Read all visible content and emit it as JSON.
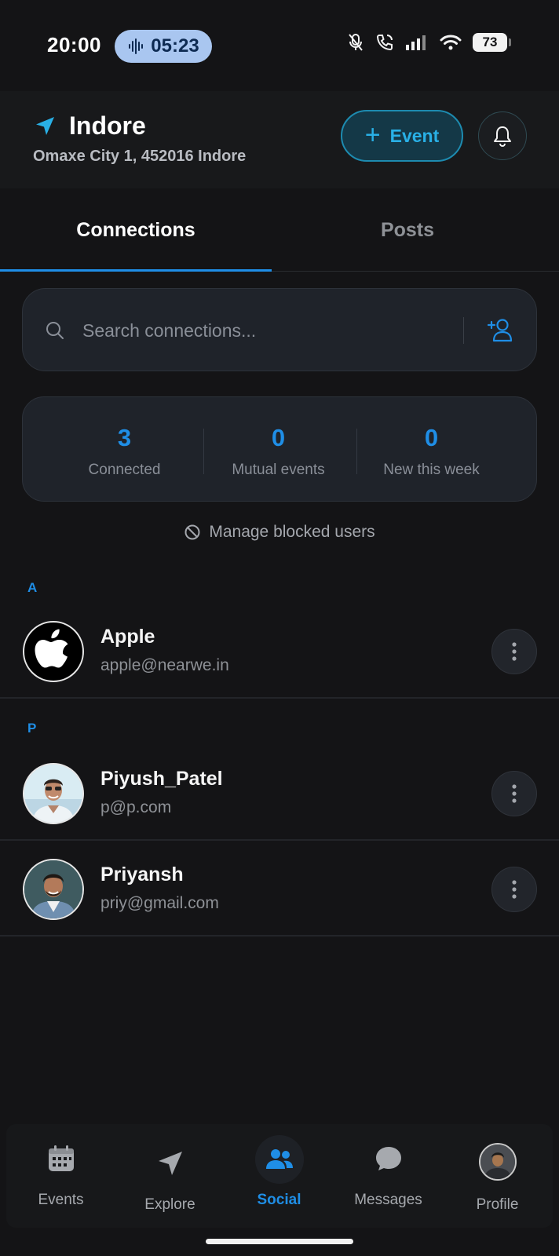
{
  "status_bar": {
    "time": "20:00",
    "call_timer": "05:23",
    "battery": "73",
    "icons": [
      "waveform-icon",
      "mic-off-icon",
      "wifi-calling-icon",
      "signal-icon",
      "wifi-icon",
      "battery-icon"
    ]
  },
  "header": {
    "city": "Indore",
    "address": "Omaxe City 1, 452016 Indore",
    "event_button_label": "Event",
    "accent_color": "#29b0e6"
  },
  "tabs": [
    {
      "label": "Connections",
      "active": true
    },
    {
      "label": "Posts",
      "active": false
    }
  ],
  "search": {
    "placeholder": "Search connections...",
    "value": ""
  },
  "stats": [
    {
      "value": "3",
      "label": "Connected"
    },
    {
      "value": "0",
      "label": "Mutual events"
    },
    {
      "value": "0",
      "label": "New this week"
    }
  ],
  "blocked_link": "Manage blocked users",
  "sections": [
    {
      "letter": "A",
      "contacts": [
        {
          "name": "Apple",
          "email": "apple@nearwe.in",
          "avatar": "apple-logo"
        }
      ]
    },
    {
      "letter": "P",
      "contacts": [
        {
          "name": "Piyush_Patel",
          "email": "p@p.com",
          "avatar": "photo"
        },
        {
          "name": "Priyansh",
          "email": "priy@gmail.com",
          "avatar": "photo"
        }
      ]
    }
  ],
  "bottom_nav": [
    {
      "label": "Events",
      "icon": "calendar-icon",
      "active": false
    },
    {
      "label": "Explore",
      "icon": "navigation-arrow-icon",
      "active": false
    },
    {
      "label": "Social",
      "icon": "people-icon",
      "active": true
    },
    {
      "label": "Messages",
      "icon": "chat-bubble-icon",
      "active": false
    },
    {
      "label": "Profile",
      "icon": "avatar",
      "active": false
    }
  ],
  "colors": {
    "background": "#141416",
    "primary_blue": "#1f8ee6",
    "card": "#1f232a"
  }
}
